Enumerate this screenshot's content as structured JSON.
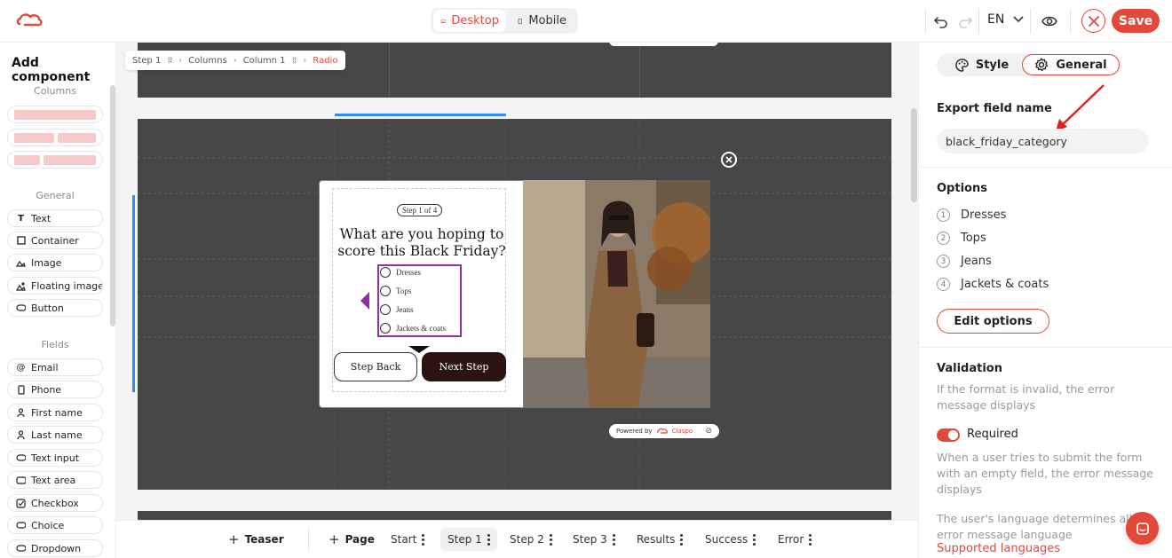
{
  "header": {
    "device_tabs": [
      {
        "label": "Desktop",
        "active": true
      },
      {
        "label": "Mobile",
        "active": false
      }
    ],
    "language": "EN",
    "save_label": "Save",
    "brand_color": "#e2493a"
  },
  "sidebar": {
    "title": "Add component",
    "columns_label": "Columns",
    "general_label": "General",
    "general_items": [
      {
        "label": "Text",
        "icon": "text-icon"
      },
      {
        "label": "Container",
        "icon": "square-icon"
      },
      {
        "label": "Image",
        "icon": "image-icon"
      },
      {
        "label": "Floating image",
        "icon": "floating-image-icon"
      },
      {
        "label": "Button",
        "icon": "button-icon"
      }
    ],
    "fields_label": "Fields",
    "field_items": [
      {
        "label": "Email",
        "icon": "at-icon"
      },
      {
        "label": "Phone",
        "icon": "phone-icon"
      },
      {
        "label": "First name",
        "icon": "person-icon"
      },
      {
        "label": "Last name",
        "icon": "person-icon"
      },
      {
        "label": "Text input",
        "icon": "input-icon"
      },
      {
        "label": "Text area",
        "icon": "textarea-icon"
      },
      {
        "label": "Checkbox",
        "icon": "checkbox-icon"
      },
      {
        "label": "Choice",
        "icon": "choice-icon"
      },
      {
        "label": "Dropdown",
        "icon": "dropdown-icon"
      }
    ]
  },
  "canvas": {
    "breadcrumb": [
      "Step 1",
      "Columns",
      "Column 1",
      "Radio"
    ],
    "popup": {
      "step_badge": "Step 1 of 4",
      "question": "What are you hoping to score this Black Friday?",
      "options": [
        "Dresses",
        "Tops",
        "Jeans",
        "Jackets & coats"
      ],
      "back_label": "Step Back",
      "next_label": "Next Step"
    },
    "powered_by": "Powered by",
    "brand": "Claspo"
  },
  "bottombar": {
    "teaser_label": "Teaser",
    "page_label": "Page",
    "pages": [
      {
        "label": "Start",
        "active": false
      },
      {
        "label": "Step 1",
        "active": true
      },
      {
        "label": "Step 2",
        "active": false
      },
      {
        "label": "Step 3",
        "active": false
      },
      {
        "label": "Results",
        "active": false
      },
      {
        "label": "Success",
        "active": false
      },
      {
        "label": "Error",
        "active": false
      }
    ]
  },
  "panel": {
    "tabs": [
      {
        "label": "Style",
        "active": false
      },
      {
        "label": "General",
        "active": true
      }
    ],
    "export_label": "Export field name",
    "export_value": "black_friday_category",
    "options_label": "Options",
    "options": [
      "Dresses",
      "Tops",
      "Jeans",
      "Jackets & coats"
    ],
    "edit_options_label": "Edit options",
    "validation_label": "Validation",
    "validation_text": "If the format is invalid, the error message displays",
    "required_label": "Required",
    "required_on": true,
    "required_text": "When a user tries to submit the form with an empty field, the error message displays",
    "language_text": "The user's language determines all error message language",
    "supported_link": "Supported languages"
  }
}
